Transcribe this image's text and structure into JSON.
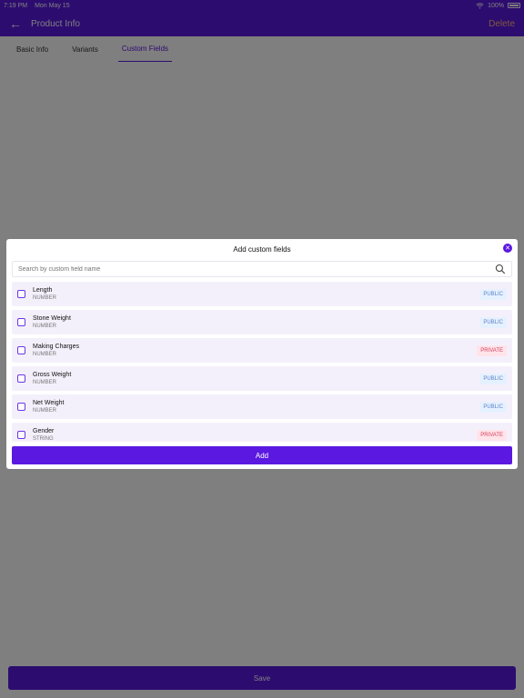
{
  "status_bar": {
    "time": "7:19 PM",
    "date": "Mon May 15",
    "battery": "100%"
  },
  "app_bar": {
    "title": "Product Info",
    "delete_label": "Delete"
  },
  "tabs": [
    {
      "label": "Basic Info"
    },
    {
      "label": "Variants"
    },
    {
      "label": "Custom Fields"
    }
  ],
  "footer": {
    "save_label": "Save"
  },
  "modal": {
    "title": "Add custom fields",
    "search_placeholder": "Search by custom field name",
    "add_label": "Add",
    "items": [
      {
        "name": "Length",
        "type": "NUMBER",
        "visibility": "PUBLIC"
      },
      {
        "name": "Stone Weight",
        "type": "NUMBER",
        "visibility": "PUBLIC"
      },
      {
        "name": "Making Charges",
        "type": "NUMBER",
        "visibility": "PRIVATE"
      },
      {
        "name": "Gross Weight",
        "type": "NUMBER",
        "visibility": "PUBLIC"
      },
      {
        "name": "Net Weight",
        "type": "NUMBER",
        "visibility": "PUBLIC"
      },
      {
        "name": "Gender",
        "type": "STRING",
        "visibility": "PRIVATE"
      }
    ]
  },
  "colors": {
    "primary": "#5b18e0",
    "delete": "#ffb37a",
    "public_bg": "#e6f1ff",
    "private_bg": "#ffe4ea"
  },
  "icons": {
    "back": "arrow-left-icon",
    "close": "close-icon",
    "search": "search-icon",
    "wifi": "wifi-icon",
    "battery": "battery-icon"
  }
}
